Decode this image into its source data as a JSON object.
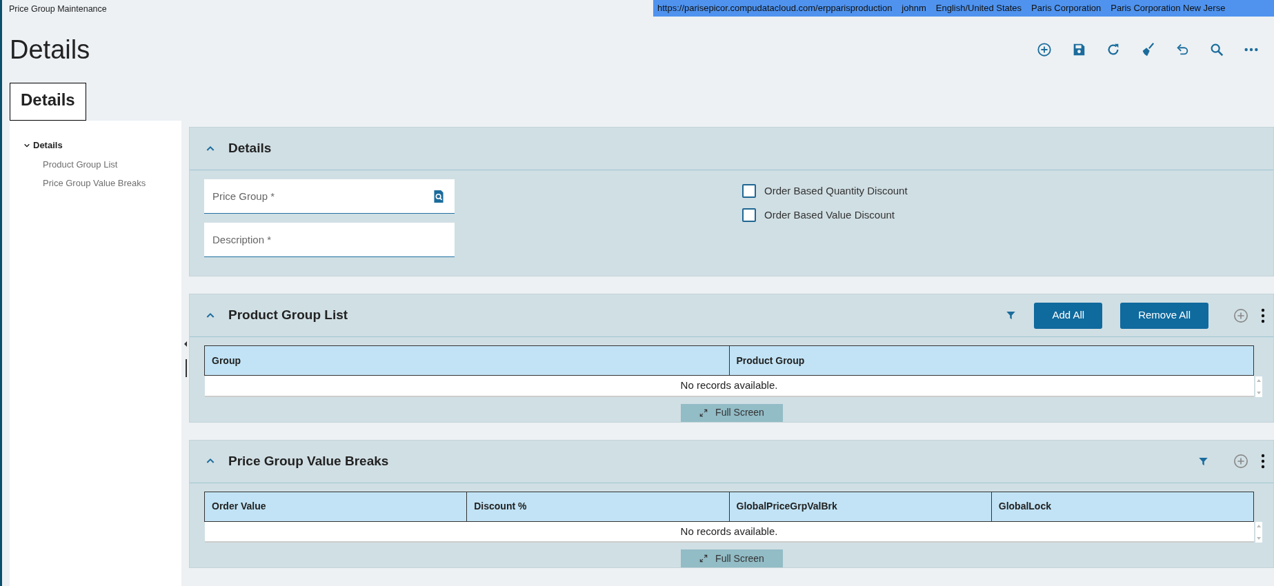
{
  "app_title": "Price Group Maintenance",
  "session_bar": [
    "https://parisepicor.compudatacloud.com/erpparisproduction",
    "johnm",
    "English/United States",
    "Paris Corporation",
    "Paris Corporation New Jerse"
  ],
  "page_title": "Details",
  "tabs": [
    {
      "label": "Details",
      "selected": true
    }
  ],
  "tree": [
    {
      "label": "Details",
      "expanded": true,
      "children": [
        {
          "label": "Product Group List"
        },
        {
          "label": "Price Group Value Breaks"
        }
      ]
    }
  ],
  "panels": [
    {
      "kind": "form",
      "title": "Details",
      "expanded": true,
      "fields": [
        {
          "placeholder": "Price Group *",
          "kind": "lookup"
        },
        {
          "placeholder": "Description *",
          "kind": "text"
        }
      ],
      "checkboxes": [
        {
          "label": "Order Based Quantity Discount",
          "checked": false
        },
        {
          "label": "Order Based Value Discount",
          "checked": false
        }
      ]
    },
    {
      "kind": "grid",
      "title": "Product Group List",
      "expanded": true,
      "buttons": [
        "Add All",
        "Remove All"
      ],
      "columns": [
        "Group",
        "Product Group"
      ],
      "empty_text": "No records available.",
      "full_screen": "Full Screen"
    },
    {
      "kind": "grid",
      "title": "Price Group Value Breaks",
      "expanded": true,
      "columns": [
        "Order Value",
        "Discount %",
        "GlobalPriceGrpValBrk",
        "GlobalLock"
      ],
      "empty_text": "No records available.",
      "full_screen": "Full Screen"
    }
  ]
}
